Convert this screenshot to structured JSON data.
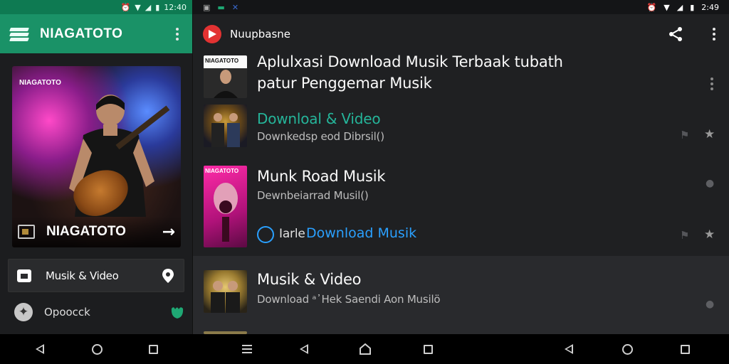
{
  "left_app": {
    "status_time": "12:40",
    "title": "NIAGATOTO",
    "card": {
      "watermark": "NIAGATOTO",
      "name": "NIAGATOTO",
      "arrow": "→"
    },
    "menu": [
      {
        "label": "Musik & Video"
      },
      {
        "label": "Opoocck"
      }
    ]
  },
  "right_app": {
    "status_time": "2:49",
    "title": "Nuupbasne",
    "items": [
      {
        "title_line1": "Aplulxasi Download Musik Terbaak tubath",
        "title_line2": "patur Penggemar Musik",
        "link": "Downloal & Video",
        "subtitle": "Downkedsp eod Dibrsil()"
      },
      {
        "title": "Munk Road Musik",
        "subtitle": "Dewnbeiarrad Musil()",
        "link_prefix": "Iarle",
        "link": "Download Musik",
        "thumb_label": "NIAGATOTO"
      },
      {
        "title": "Musik & Video",
        "subtitle": "Download ᵃ᾿Hek Saendi Aon Musilö"
      }
    ]
  },
  "thumb1_label": "NIAGATOTO",
  "colors": {
    "accent_green": "#1a9267",
    "teal_link": "#25b59a",
    "blue_link": "#2aa0ff",
    "app_red": "#e23232"
  }
}
